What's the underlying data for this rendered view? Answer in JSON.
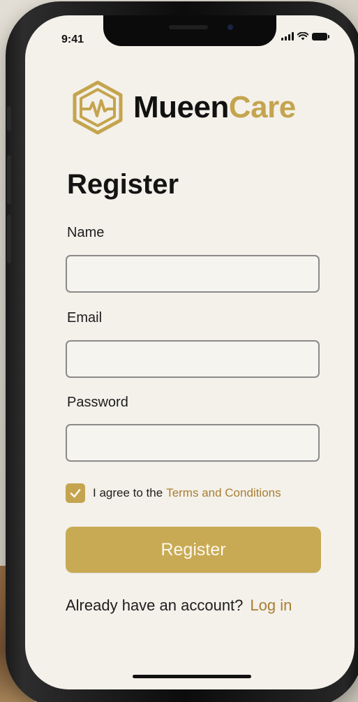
{
  "status_bar": {
    "time": "9:41",
    "icons": [
      "signal-icon",
      "wifi-icon",
      "battery-icon"
    ]
  },
  "brand": {
    "name_part1": "Mueen",
    "name_part2": "Care",
    "icon": "hexagon-heartbeat-icon",
    "colors": {
      "dark": "#111111",
      "accent": "#c4a44e"
    }
  },
  "form": {
    "title": "Register",
    "fields": [
      {
        "label": "Name",
        "value": "",
        "placeholder": ""
      },
      {
        "label": "Email",
        "value": "",
        "placeholder": ""
      },
      {
        "label": "Password",
        "value": "",
        "placeholder": ""
      }
    ],
    "agree": {
      "checked": true,
      "text": "I agree to the",
      "link_text": "Terms and Conditions"
    },
    "submit_label": "Register"
  },
  "footer": {
    "prompt": "Already have an account?",
    "link_text": "Log in"
  },
  "colors": {
    "background": "#f4f1ea",
    "button": "#c8aa54",
    "link": "#a97e33"
  }
}
